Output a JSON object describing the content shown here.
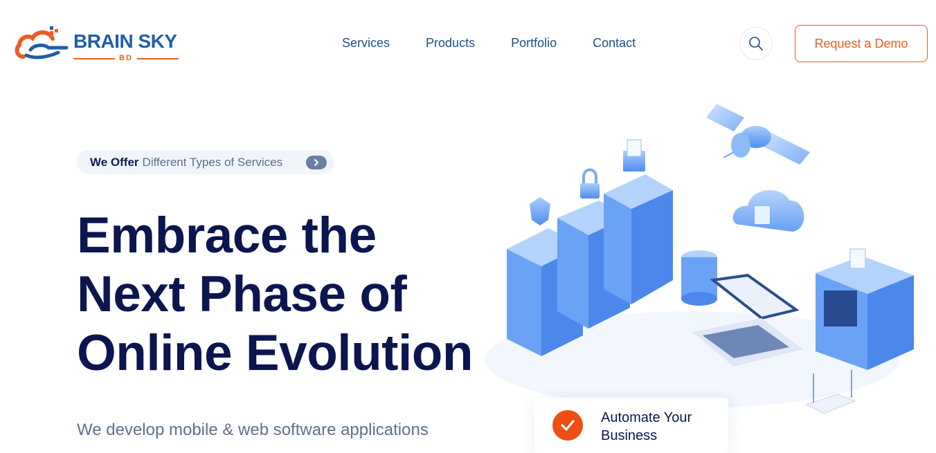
{
  "brand": {
    "name": "BRAIN SKY",
    "sub": "BD"
  },
  "nav": {
    "items": [
      "Services",
      "Products",
      "Portfolio",
      "Contact"
    ]
  },
  "header": {
    "demo_label": "Request a Demo",
    "search_icon": "search-icon"
  },
  "hero": {
    "pill_strong": "We Offer",
    "pill_rest": "Different Types of Services",
    "title_lines": [
      "Embrace the",
      "Next Phase of",
      "Online Evolution"
    ],
    "subtitle": "We develop mobile & web software applications"
  },
  "feature": {
    "title": "Automate Your Business"
  },
  "colors": {
    "accent": "#ef5a24",
    "navy": "#0b1650",
    "nav": "#1c4e8a",
    "illustration": "#5b9af0"
  }
}
